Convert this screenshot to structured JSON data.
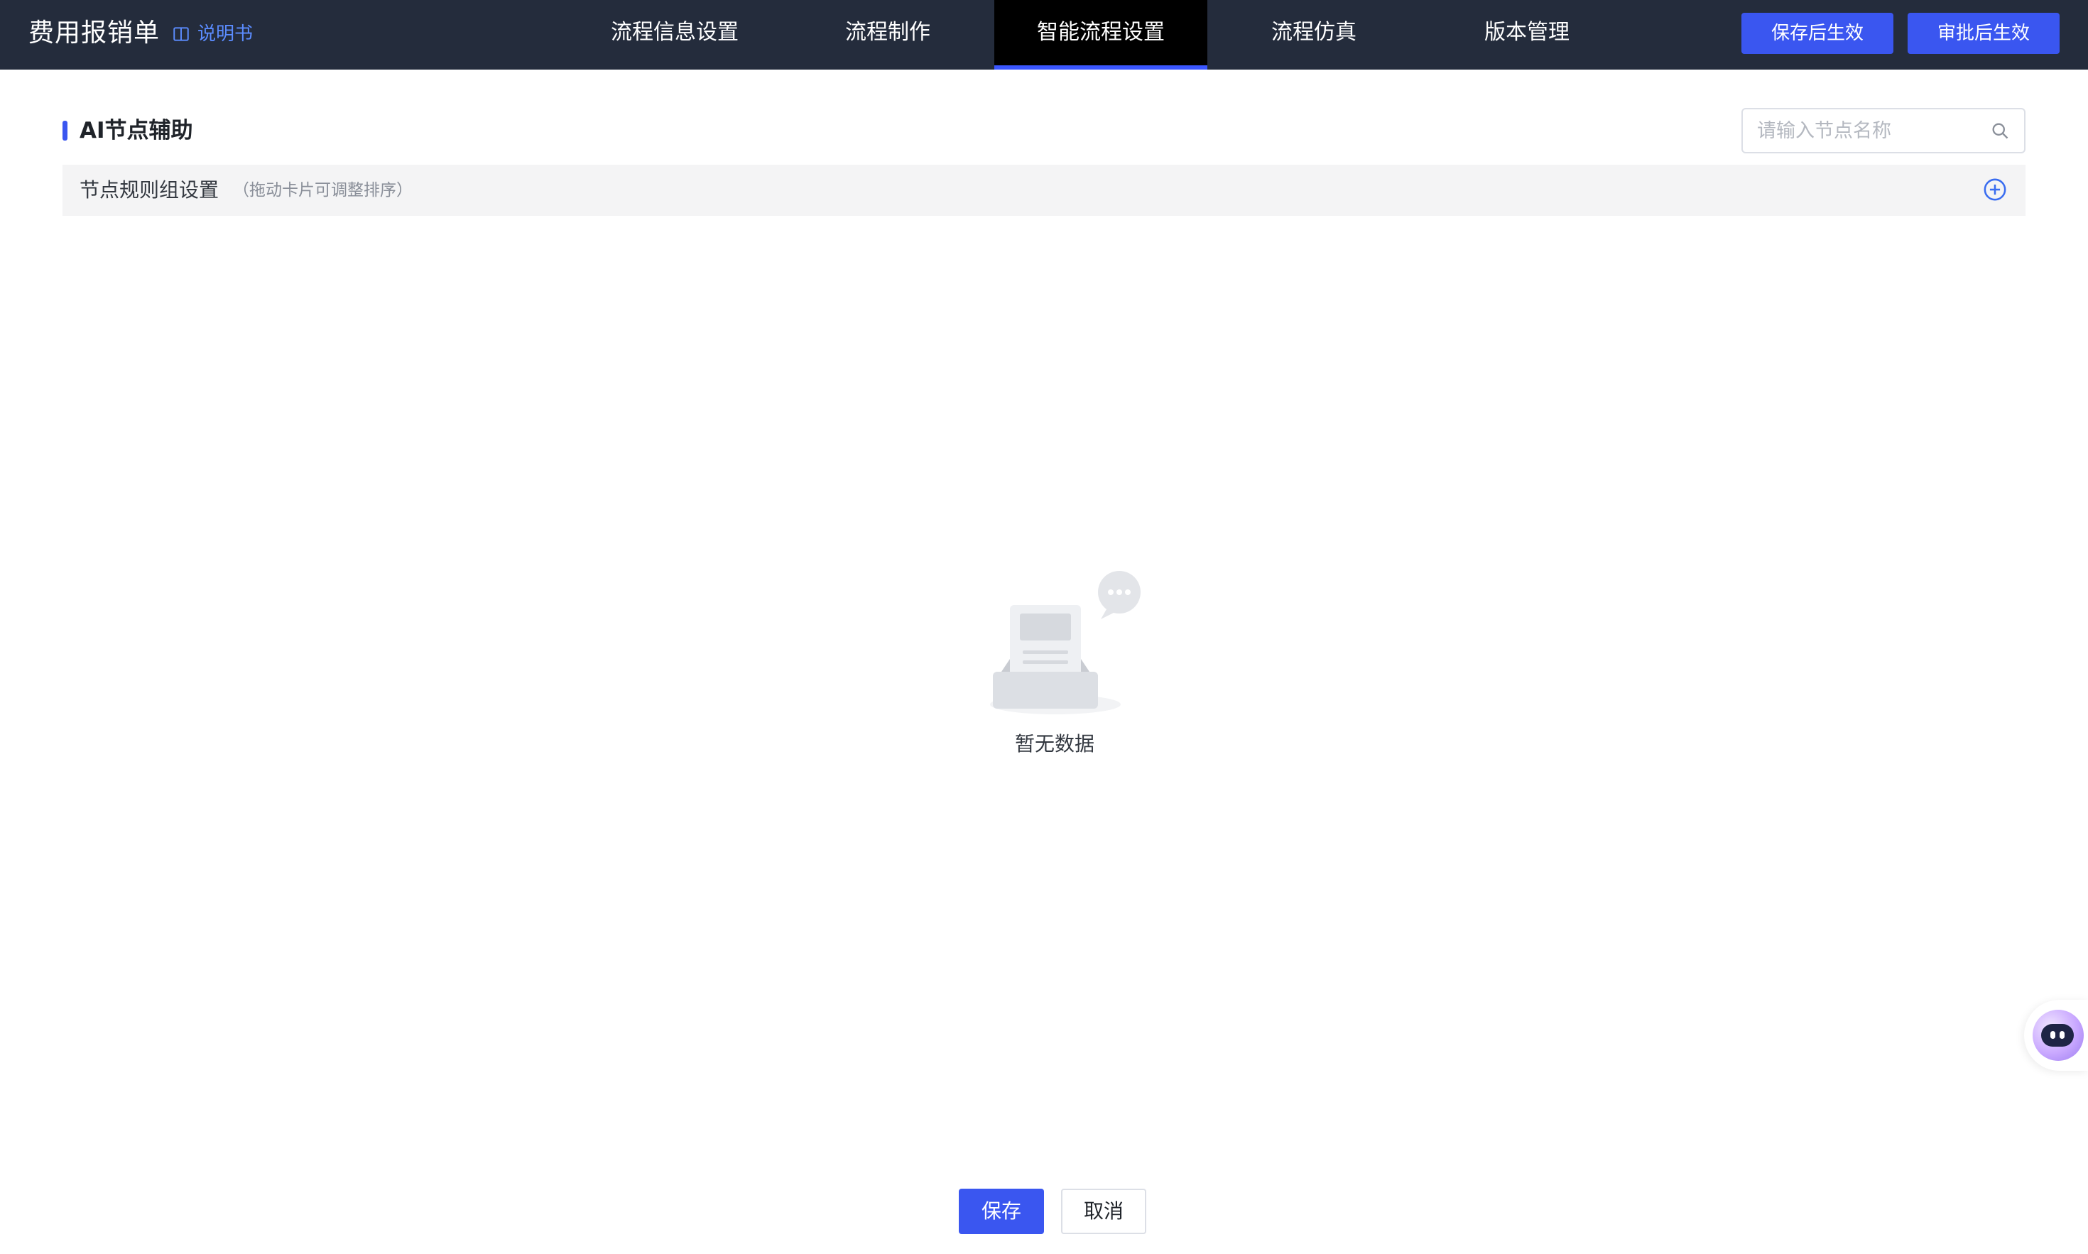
{
  "app": {
    "title": "费用报销单",
    "manual_link": "说明书"
  },
  "nav": {
    "tabs": [
      {
        "label": "流程信息设置",
        "active": false
      },
      {
        "label": "流程制作",
        "active": false
      },
      {
        "label": "智能流程设置",
        "active": true
      },
      {
        "label": "流程仿真",
        "active": false
      },
      {
        "label": "版本管理",
        "active": false
      }
    ],
    "actions": [
      {
        "label": "保存后生效"
      },
      {
        "label": "审批后生效"
      }
    ]
  },
  "section": {
    "title": "AI节点辅助",
    "search": {
      "placeholder": "请输入节点名称",
      "value": ""
    }
  },
  "rule_group": {
    "title": "节点规则组设置",
    "hint": "（拖动卡片可调整排序）",
    "add_icon": "plus-circle-icon"
  },
  "empty_state": {
    "text": "暂无数据",
    "icon": "empty-inbox-icon"
  },
  "footer": {
    "save_label": "保存",
    "cancel_label": "取消"
  },
  "colors": {
    "topbar_bg": "#242c3c",
    "active_tab_bg": "#000000",
    "accent": "#3a56f0"
  }
}
